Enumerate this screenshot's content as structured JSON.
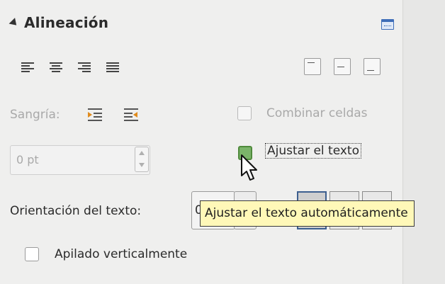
{
  "section": {
    "title": "Alineación",
    "more_options_icon": "more-options-icon"
  },
  "horizontal_alignment": {
    "icons": [
      "align-left-icon",
      "align-center-icon",
      "align-right-icon",
      "align-justify-icon"
    ]
  },
  "vertical_alignment": {
    "icons": [
      "align-top-icon",
      "align-middle-icon",
      "align-bottom-icon"
    ]
  },
  "indent": {
    "label": "Sangría:",
    "icons": [
      "increase-indent-icon",
      "decrease-indent-icon"
    ],
    "value": "0 pt"
  },
  "merge_cells": {
    "label": "Combinar celdas",
    "checked": false
  },
  "wrap_text": {
    "label": "Ajustar el texto",
    "checked": true
  },
  "text_orientation": {
    "label": "Orientación del texto:",
    "combo_value": "0"
  },
  "tooltip": {
    "text": "Ajustar el texto automáticamente"
  },
  "stacked_vertically": {
    "label": "Apilado verticalmente",
    "checked": false
  },
  "colors": {
    "panel_bg": "#efefee",
    "tooltip_bg": "#fff8b8",
    "checkbox_checked": "#7bb46a",
    "selected_button_border": "#3d5f8f"
  }
}
